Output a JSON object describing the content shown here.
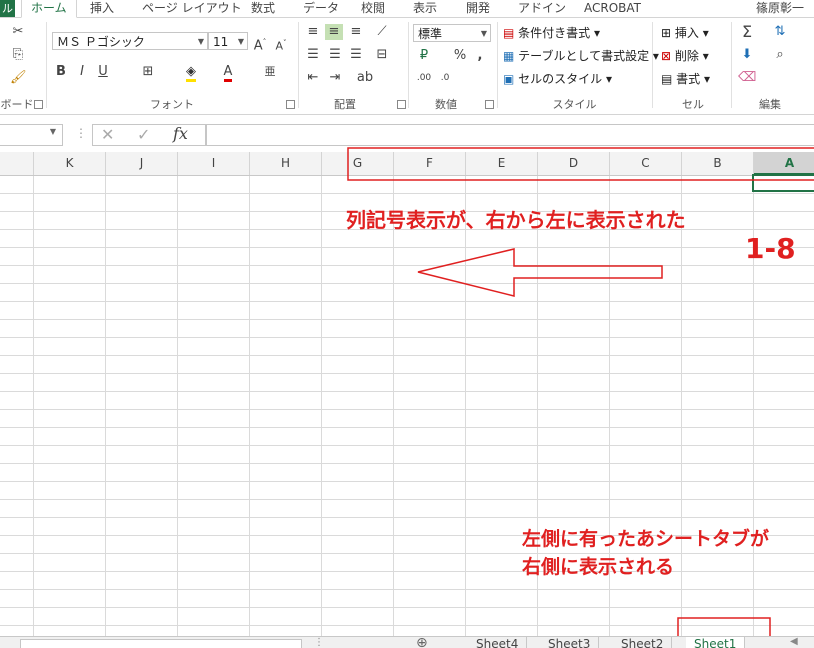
{
  "tabs": [
    "ホーム",
    "挿入",
    "ページ レイアウト",
    "数式",
    "データ",
    "校閲",
    "表示",
    "開発",
    "アドイン",
    "ACROBAT"
  ],
  "user_name": "篠原彰一",
  "file_stub": "ル",
  "ribbon": {
    "clipboard_label": "ボード",
    "font_group_label": "フォント",
    "font_name": "ＭＳ Ｐゴシック",
    "font_size": "11",
    "alignment_label": "配置",
    "number_label": "数値",
    "number_format": "標準",
    "styles_label": "スタイル",
    "conditional_format": "条件付き書式",
    "format_as_table": "テーブルとして書式設定",
    "cell_styles": "セルのスタイル",
    "cells_label": "セル",
    "insert_label": "挿入",
    "delete_label": "削除",
    "format_label": "書式",
    "editing_label": "編集"
  },
  "formula_bar": {
    "fx": "fx",
    "value": ""
  },
  "columns": [
    "K",
    "J",
    "I",
    "H",
    "G",
    "F",
    "E",
    "D",
    "C",
    "B",
    "A"
  ],
  "sheets": [
    "Sheet4",
    "Sheet3",
    "Sheet2",
    "Sheet1"
  ],
  "active_sheet": "Sheet1",
  "annotations": {
    "main": "列記号表示が、右から左に表示された",
    "number": "1-8",
    "tabs_line1": "左側に有ったあシートタブが",
    "tabs_line2": "右側に表示される"
  },
  "colors": {
    "accent": "#217346",
    "annotation": "#e02020"
  }
}
